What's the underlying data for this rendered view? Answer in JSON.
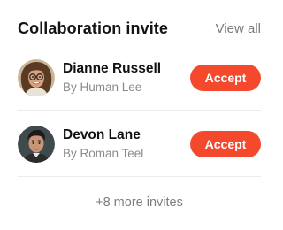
{
  "header": {
    "title": "Collaboration invite",
    "view_all_label": "View all"
  },
  "invites": [
    {
      "name": "Dianne Russell",
      "from": "By Human Lee",
      "accept_label": "Accept",
      "avatar": "woman-with-glasses-avatar"
    },
    {
      "name": "Devon Lane",
      "from": "By Roman Teel",
      "accept_label": "Accept",
      "avatar": "man-with-dark-hair-avatar"
    }
  ],
  "more_label": "+8 more invites",
  "colors": {
    "accent": "#f5492e",
    "title": "#141414",
    "muted": "#8a8a8a",
    "divider": "#ebebeb"
  }
}
